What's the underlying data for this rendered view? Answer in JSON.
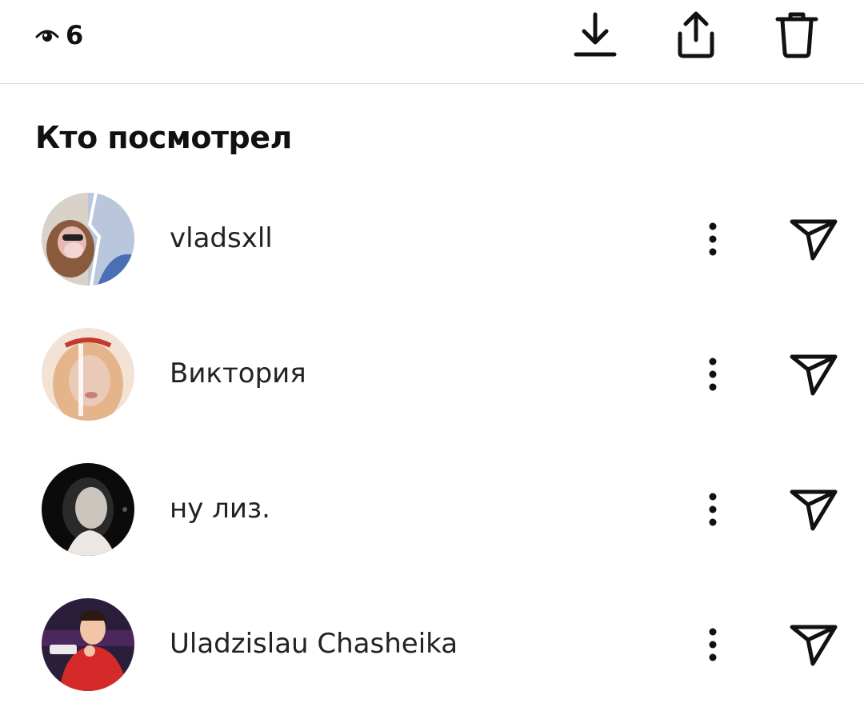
{
  "toolbar": {
    "view_count": "6",
    "icons": [
      "eye-icon",
      "download-icon",
      "share-icon",
      "trash-icon"
    ]
  },
  "section": {
    "title": "Кто посмотрел"
  },
  "viewers": [
    {
      "name": "vladsxll",
      "avatar_colors": [
        "#d8d2c8",
        "#4a6fb5",
        "#e8b9b0"
      ]
    },
    {
      "name": "Виктория",
      "avatar_colors": [
        "#e9c9b8",
        "#c23a2e",
        "#f3e2d6"
      ]
    },
    {
      "name": "ну лиз.",
      "avatar_colors": [
        "#0b0b0b",
        "#ece7e2",
        "#2a2a2a"
      ]
    },
    {
      "name": "Uladzislau Chasheika",
      "avatar_colors": [
        "#2a1e3b",
        "#d62a2a",
        "#f1c5a5"
      ]
    }
  ],
  "row_icons": [
    "more-icon",
    "send-icon"
  ]
}
